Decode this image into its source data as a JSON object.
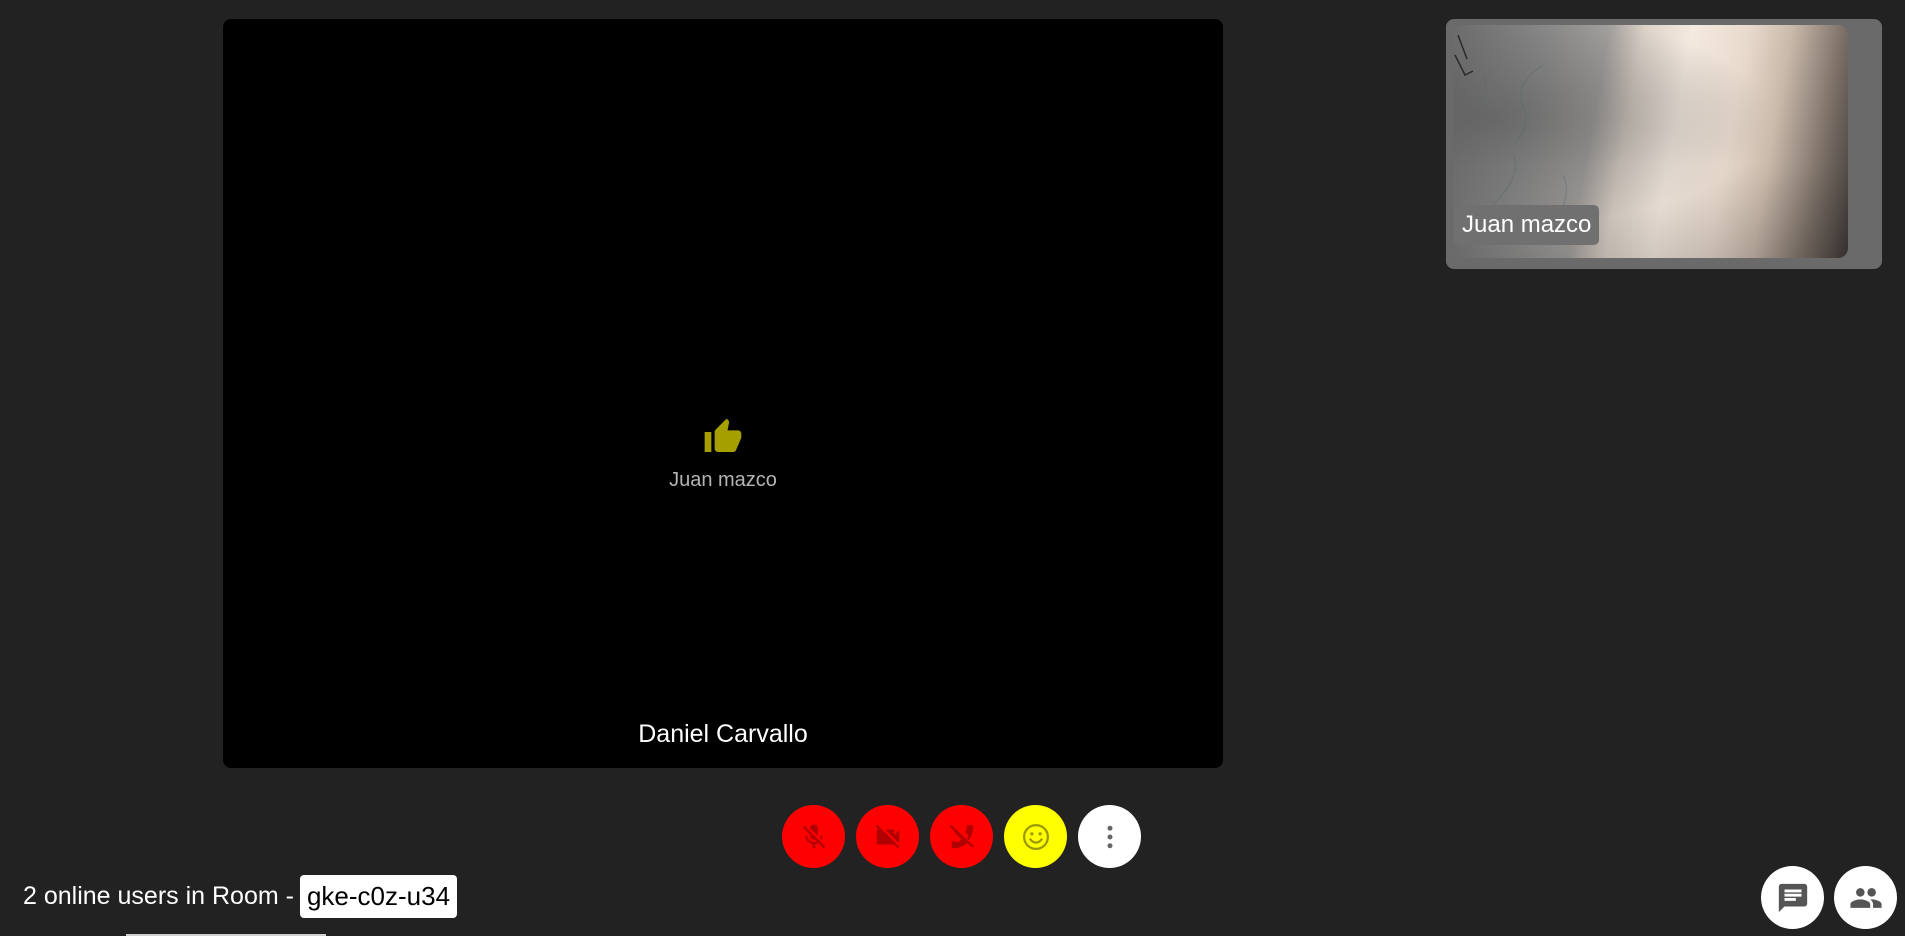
{
  "main_video": {
    "participant_name": "Daniel Carvallo",
    "reaction": {
      "icon": "thumbs-up-icon",
      "color": "#a5a000",
      "from_name": "Juan mazco"
    }
  },
  "thumbnail": {
    "participant_name": "Juan mazco"
  },
  "controls": [
    {
      "name": "mic-off",
      "icon": "mic-off-icon",
      "color": "#ff0000"
    },
    {
      "name": "camera-off",
      "icon": "videocam-off-icon",
      "color": "#ff0000"
    },
    {
      "name": "hang-up",
      "icon": "call-end-icon",
      "color": "#ff0000"
    },
    {
      "name": "reactions",
      "icon": "smiley-icon",
      "color": "#ffff00"
    },
    {
      "name": "more-options",
      "icon": "more-vert-icon",
      "color": "#ffffff"
    }
  ],
  "footer": {
    "online_text": "2 online users in Room -",
    "room_code": "gke-c0z-u34"
  },
  "side_buttons": {
    "chat_icon": "chat-icon",
    "participants_icon": "people-icon"
  }
}
